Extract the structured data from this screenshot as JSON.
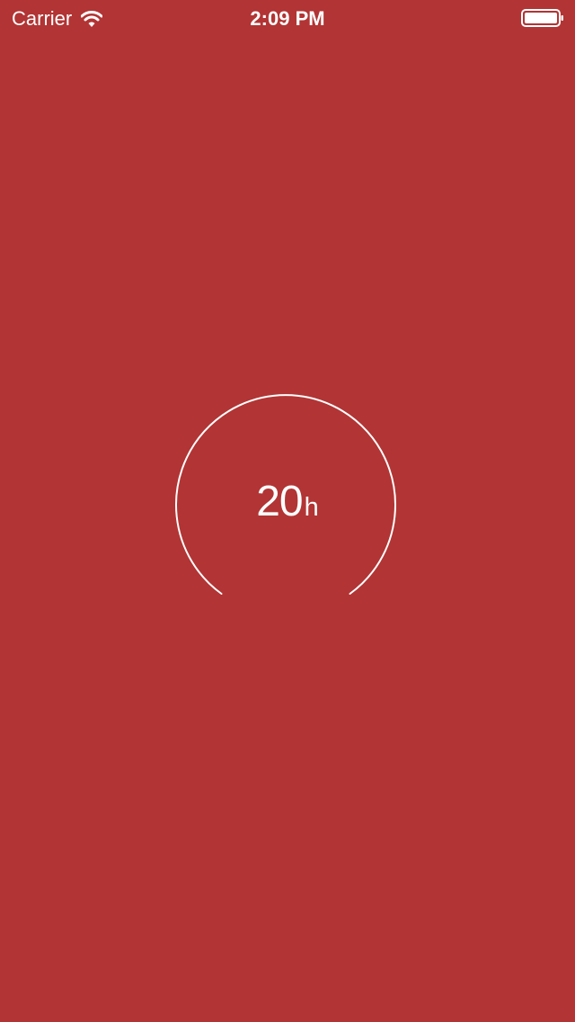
{
  "status_bar": {
    "carrier": "Carrier",
    "time": "2:09 PM",
    "icons": {
      "wifi": "wifi-icon",
      "battery": "battery-icon"
    }
  },
  "gauge": {
    "value": "20",
    "unit": "h"
  },
  "colors": {
    "background": "#b23434",
    "foreground": "#ffffff"
  }
}
